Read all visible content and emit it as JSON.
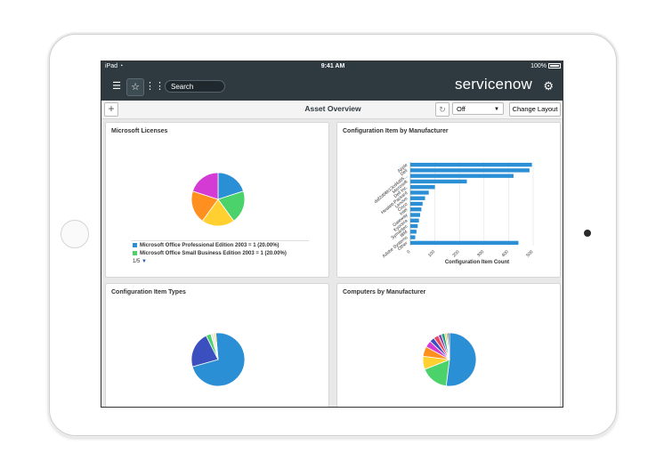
{
  "status_bar": {
    "carrier": "iPad",
    "time": "9:41 AM",
    "battery": "100%"
  },
  "header": {
    "search_placeholder": "Search",
    "brand": "servicenow"
  },
  "toolbar": {
    "title": "Asset Overview",
    "refresh_select": "Off",
    "change_layout": "Change Layout"
  },
  "colors": {
    "blue": "#2b8fd6",
    "green": "#4bd26b",
    "yellow": "#ffd030",
    "orange": "#ff8f1f",
    "magenta": "#d43bd4",
    "navy": "#3b4fbf",
    "header": "#2e3a40"
  },
  "cards": {
    "ms_licenses": {
      "title": "Microsoft Licenses",
      "legend": [
        {
          "label": "Microsoft Office Professional Edition 2003 = 1 (20.00%)",
          "color": "#2b8fd6"
        },
        {
          "label": "Microsoft Office Small Business Edition 2003 = 1 (20.00%)",
          "color": "#4bd26b"
        }
      ],
      "pager": "1/5"
    },
    "ci_by_manufacturer": {
      "title": "Configuration Item by Manufacturer"
    },
    "ci_types": {
      "title": "Configuration Item Types"
    },
    "computers_by_manufacturer": {
      "title": "Computers by Manufacturer"
    }
  },
  "chart_data": [
    {
      "type": "pie",
      "title": "Microsoft Licenses",
      "categories": [
        "Microsoft Office Professional Edition 2003",
        "Microsoft Office Small Business Edition 2003",
        "",
        "",
        ""
      ],
      "values": [
        1,
        1,
        1,
        1,
        1
      ],
      "colors": [
        "#2b8fd6",
        "#4bd26b",
        "#ffd030",
        "#ff8f1f",
        "#d43bd4"
      ]
    },
    {
      "type": "bar",
      "orientation": "horizontal",
      "title": "Configuration Item by Manufacturer",
      "xlabel": "Configuration Item Count",
      "categories": [
        "Apple",
        "Dell",
        "daf2d08b13cd4d05...",
        "Microsoft",
        "Dell Inc.",
        "Hewlett-Packard",
        "Lenovo",
        "Cisco",
        "Intel",
        "Gateway",
        "Kyocera",
        "Symantec",
        "IBM",
        "Adobe Systems",
        "Other"
      ],
      "values": [
        495,
        485,
        420,
        230,
        100,
        75,
        60,
        50,
        45,
        40,
        35,
        30,
        25,
        20,
        440
      ],
      "xticks": [
        0,
        100,
        200,
        300,
        400,
        500
      ],
      "xlim": [
        0,
        500
      ],
      "color": "#2b8fd6"
    },
    {
      "type": "pie",
      "title": "Configuration Item Types",
      "values": [
        72,
        22,
        3,
        2,
        1
      ],
      "colors": [
        "#2b8fd6",
        "#3b4fbf",
        "#4bd26b",
        "#e8e8e8",
        "#ffd030"
      ]
    },
    {
      "type": "pie",
      "title": "Computers by Manufacturer",
      "values": [
        52,
        17,
        8,
        6,
        4,
        3,
        3,
        2,
        2,
        1,
        1,
        1
      ],
      "colors": [
        "#2b8fd6",
        "#4bd26b",
        "#ffd030",
        "#ff8f1f",
        "#d43bd4",
        "#3b4fbf",
        "#e84a5f",
        "#8e44ad",
        "#16a085",
        "#f1c40f",
        "#95a5a6",
        "#34495e"
      ]
    }
  ]
}
